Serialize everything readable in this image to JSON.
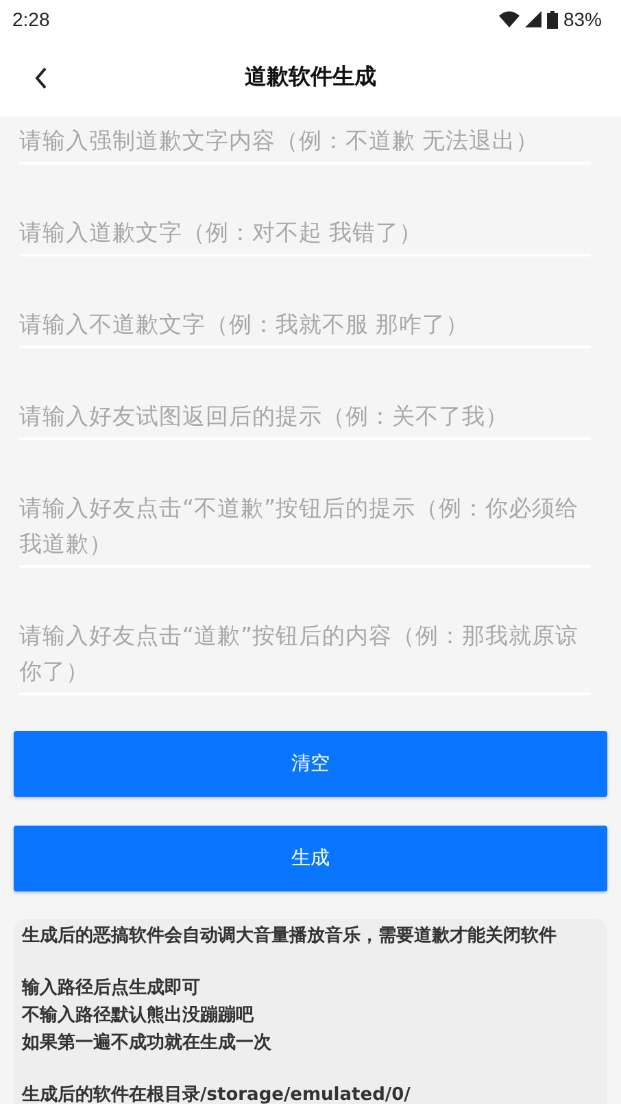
{
  "status_bar": {
    "time": "2:28",
    "battery": "83%"
  },
  "toolbar": {
    "title": "道歉软件生成"
  },
  "fields": [
    {
      "placeholder": "请输入强制道歉文字内容（例：不道歉 无法退出）"
    },
    {
      "placeholder": "请输入道歉文字（例：对不起 我错了）"
    },
    {
      "placeholder": "请输入不道歉文字（例：我就不服 那咋了）"
    },
    {
      "placeholder": "请输入好友试图返回后的提示（例：关不了我）"
    },
    {
      "placeholder": "请输入好友点击“不道歉”按钮后的提示（例：你必须给我道歉）"
    },
    {
      "placeholder": "请输入好友点击“道歉”按钮后的内容（例：那我就原谅你了）"
    }
  ],
  "buttons": [
    "清空",
    "生成"
  ],
  "notes": [
    [
      "生成后的恶搞软件会自动调大音量播放音乐，需要道歉才能关闭软件"
    ],
    [
      "输入路径后点生成即可",
      "不输入路径默认熊出没蹦蹦吧",
      "如果第一遍不成功就在生成一次"
    ],
    [
      "生成后的软件在根目录/storage/emulated/0/"
    ]
  ]
}
